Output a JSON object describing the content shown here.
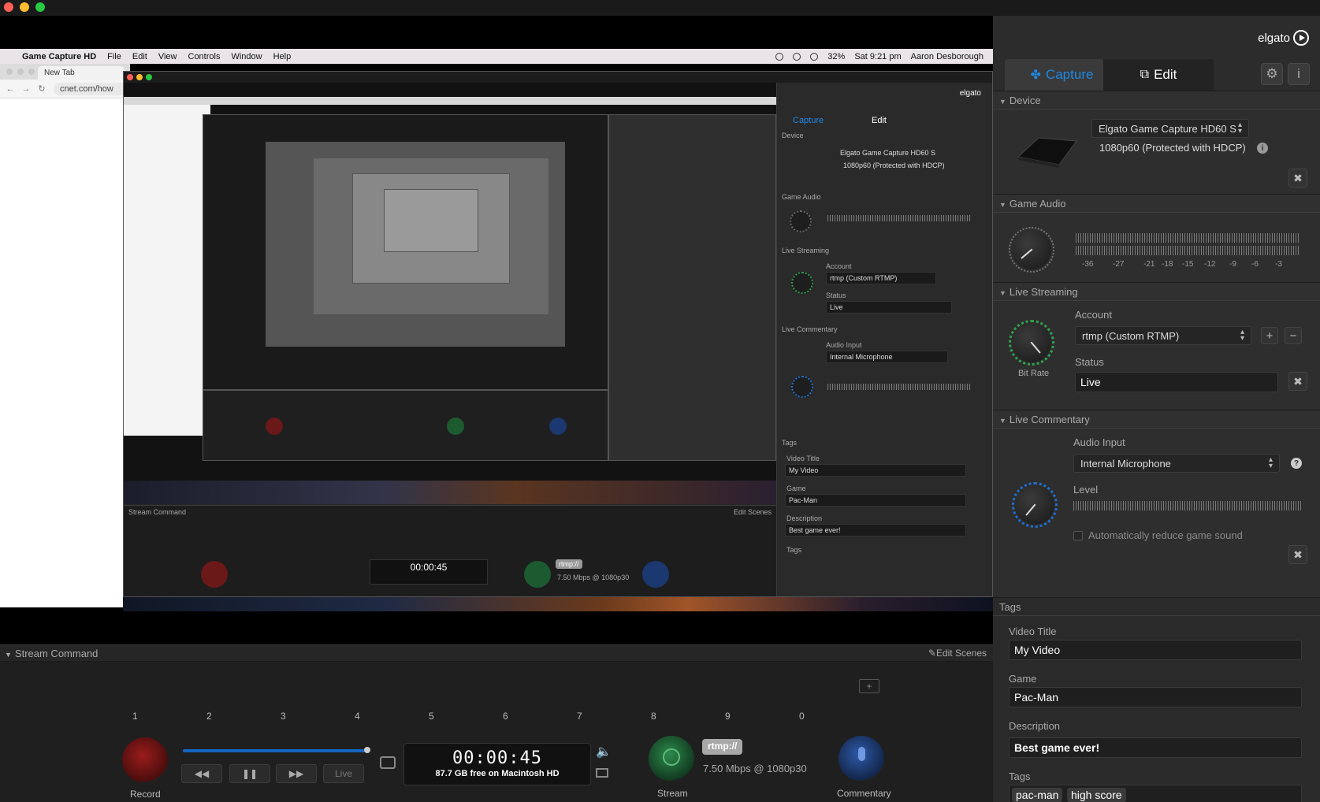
{
  "window": {
    "title": "Game Capture HD"
  },
  "menubar": {
    "app": "Game Capture HD",
    "items": [
      "File",
      "Edit",
      "View",
      "Controls",
      "Window",
      "Help"
    ],
    "battery": "32%",
    "clock": "Sat 9:21 pm",
    "user": "Aaron Desborough"
  },
  "browser": {
    "tab": "New Tab",
    "url": "cnet.com/how"
  },
  "brand": "elgato",
  "tabs": {
    "capture": "Capture",
    "edit": "Edit"
  },
  "device": {
    "header": "Device",
    "name": "Elgato Game Capture HD60 S",
    "mode": "1080p60 (Protected with HDCP)"
  },
  "game_audio": {
    "header": "Game Audio",
    "scale": [
      "-36",
      "-27",
      "-21",
      "-18",
      "-15",
      "-12",
      "-9",
      "-6",
      "-3"
    ]
  },
  "live_streaming": {
    "header": "Live Streaming",
    "account_label": "Account",
    "account_value": "rtmp (Custom RTMP)",
    "status_label": "Status",
    "status_value": "Live",
    "bitrate_label": "Bit Rate"
  },
  "live_commentary": {
    "header": "Live Commentary",
    "audio_input_label": "Audio Input",
    "audio_input_value": "Internal Microphone",
    "level_label": "Level",
    "reduce_label": "Automatically reduce game sound"
  },
  "tags_section": {
    "header": "Tags",
    "video_title_label": "Video Title",
    "video_title_value": "My Video",
    "game_label": "Game",
    "game_value": "Pac-Man",
    "description_label": "Description",
    "description_value": "Best game ever!",
    "tags_label": "Tags",
    "tags": [
      "pac-man",
      "high score"
    ]
  },
  "stream_command": {
    "header": "Stream Command",
    "edit_scenes": "Edit Scenes",
    "scenes": [
      "1",
      "2",
      "3",
      "4",
      "5",
      "6",
      "7",
      "8",
      "9",
      "0"
    ],
    "record_label": "Record",
    "live_label": "Live",
    "timer": "00:00:45",
    "free_space": "87.7 GB free on Macintosh HD",
    "rtmp_badge": "rtmp://",
    "bitrate": "7.50 Mbps @ 1080p30",
    "stream_label": "Stream",
    "commentary_label": "Commentary"
  },
  "colors": {
    "accent": "#1e88e5",
    "record": "#8b1a1a",
    "stream": "#1f6b3a",
    "commentary": "#1f3f7a"
  }
}
